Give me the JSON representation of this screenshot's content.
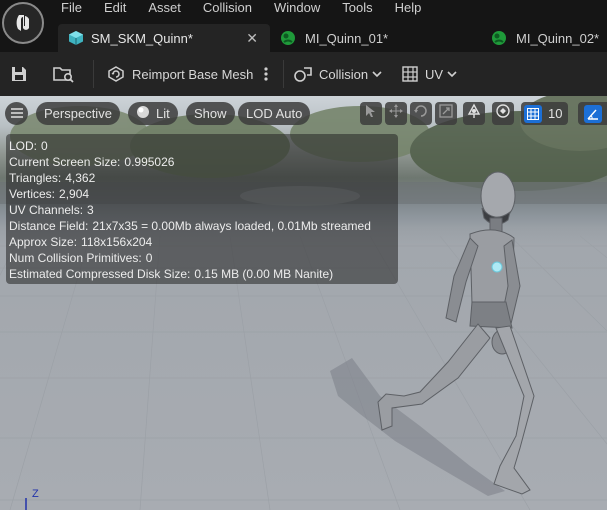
{
  "menu": [
    "File",
    "Edit",
    "Asset",
    "Collision",
    "Window",
    "Tools",
    "Help"
  ],
  "tabs": [
    {
      "label": "SM_SKM_Quinn*",
      "active": true,
      "icon": "static-mesh-icon"
    },
    {
      "label": "MI_Quinn_01*",
      "active": false,
      "icon": "material-instance-icon"
    },
    {
      "label": "MI_Quinn_02*",
      "active": false,
      "icon": "material-instance-icon"
    }
  ],
  "toolbar": {
    "reimport_label": "Reimport Base Mesh",
    "collision_label": "Collision",
    "uv_label": "UV"
  },
  "viewport": {
    "perspective_label": "Perspective",
    "lit_label": "Lit",
    "show_label": "Show",
    "lod_label": "LOD Auto",
    "grid_snap_value": "10"
  },
  "stats": [
    {
      "label": "LOD:",
      "value": "0"
    },
    {
      "label": "Current Screen Size:",
      "value": "0.995026"
    },
    {
      "label": "Triangles:",
      "value": "4,362"
    },
    {
      "label": "Vertices:",
      "value": "2,904"
    },
    {
      "label": "UV Channels:",
      "value": "3"
    },
    {
      "label": "Distance Field:",
      "value": "21x7x35 = 0.00Mb always loaded, 0.01Mb streamed"
    },
    {
      "label": "Approx Size:",
      "value": "118x156x204"
    },
    {
      "label": "Num Collision Primitives:",
      "value": "0"
    },
    {
      "label": "Estimated Compressed Disk Size:",
      "value": "0.15 MB (0.00 MB Nanite)"
    }
  ],
  "axis_label": "Z",
  "colors": {
    "accent_blue": "#1c6fd6",
    "tab_active": "#242424",
    "mi_icon_green": "#1f9a3a",
    "mesh_icon_teal": "#3fb3c0"
  }
}
